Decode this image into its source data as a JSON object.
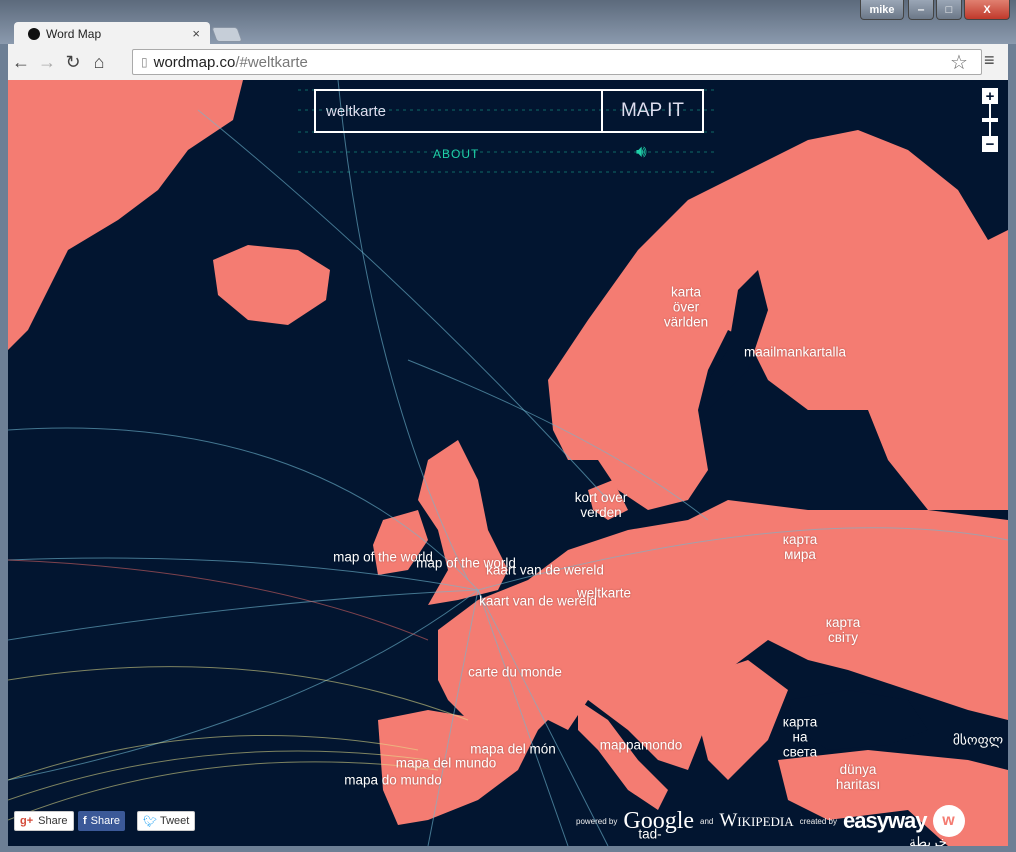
{
  "browser": {
    "tab_title": "Word Map",
    "profile": "mike",
    "url_host": "wordmap.co",
    "url_path": "/#weltkarte",
    "close_tab": "×",
    "minimize": "‒",
    "maximize": "□",
    "close": "X"
  },
  "search": {
    "value": "weltkarte",
    "button": "MAP IT",
    "about": "ABOUT",
    "sound_icon": "speaker-icon"
  },
  "zoom": {
    "in": "+",
    "out": "−"
  },
  "labels": [
    {
      "text": "karta\növer\nvärlden"
    },
    {
      "text": "maailmankartalla"
    },
    {
      "text": "kort over\nverden"
    },
    {
      "text": "map of the world"
    },
    {
      "text": "map of the world"
    },
    {
      "text": "kaart van de wereld"
    },
    {
      "text": "weltkarte"
    },
    {
      "text": "kaart van de wereld"
    },
    {
      "text": "карта\nмира"
    },
    {
      "text": "карта\nсвіту"
    },
    {
      "text": "carte du monde"
    },
    {
      "text": "карта\nна\nсвета"
    },
    {
      "text": "mapa del món"
    },
    {
      "text": "mappamondo"
    },
    {
      "text": "mapa del mundo"
    },
    {
      "text": "mapa do mundo"
    },
    {
      "text": "dünya\nharitası"
    },
    {
      "text": "მსოფლ"
    },
    {
      "text": "tad-"
    },
    {
      "text": "خريطة"
    }
  ],
  "share": {
    "gplus": "Share",
    "facebook": "Share",
    "twitter": "Tweet"
  },
  "credits": {
    "powered_by": "powered by",
    "google": "Google",
    "and": "and",
    "wikipedia": "Wikipedia",
    "created_by": "created by",
    "easyway": "easyway"
  },
  "colors": {
    "land": "#f47c72",
    "sea": "#021530",
    "accent": "#1fd0a8"
  }
}
